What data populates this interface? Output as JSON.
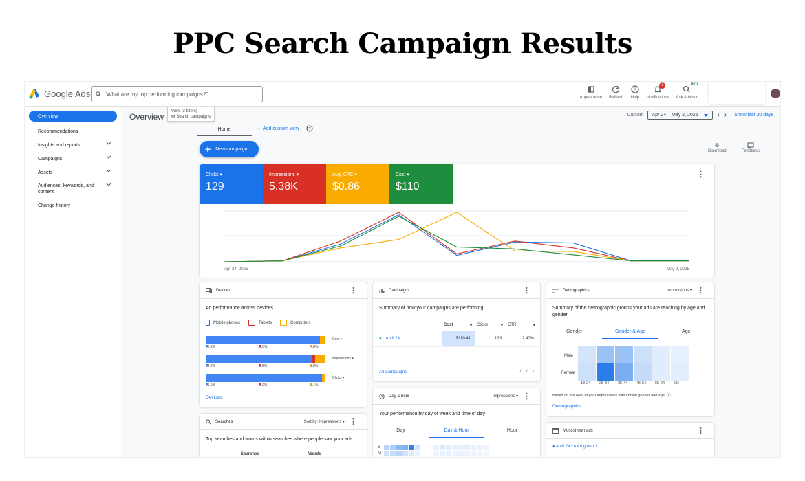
{
  "headline": "PPC Search Campaign Results",
  "topbar": {
    "product": "Google Ads",
    "search_placeholder": "\"What are my top performing campaigns?\"",
    "tools": [
      {
        "label": "Appearance",
        "icon": "appearance-icon"
      },
      {
        "label": "Refresh",
        "icon": "refresh-icon"
      },
      {
        "label": "Help",
        "icon": "help-icon"
      },
      {
        "label": "Notifications",
        "icon": "bell-icon",
        "badge": "1"
      },
      {
        "label": "Ask Advisor",
        "icon": "advisor-icon",
        "tag": "BETA"
      }
    ]
  },
  "sidebar": {
    "items": [
      {
        "label": "Overview",
        "active": true
      },
      {
        "label": "Recommendations"
      },
      {
        "label": "Insights and reports",
        "expandable": true
      },
      {
        "label": "Campaigns",
        "expandable": true
      },
      {
        "label": "Assets",
        "expandable": true
      },
      {
        "label": "Audiences, keywords, and content",
        "expandable": true
      },
      {
        "label": "Change history"
      }
    ]
  },
  "header": {
    "title": "Overview",
    "tooltip_line1": "View (3 filters)",
    "tooltip_line2": "Search campaigns",
    "custom_label": "Custom",
    "date_range": "Apr 24 – May 2, 2025",
    "show_last": "Show last 30 days",
    "tab_home": "Home",
    "add_view": "Add custom view",
    "new_campaign": "New campaign",
    "download": "Download",
    "feedback": "Feedback"
  },
  "metrics": [
    {
      "label": "Clicks",
      "value": "129",
      "color": "#1a73e8"
    },
    {
      "label": "Impressions",
      "value": "5.38K",
      "color": "#d93025"
    },
    {
      "label": "Avg. CPC",
      "value": "$0.86",
      "color": "#f9ab00"
    },
    {
      "label": "Cost",
      "value": "$110",
      "color": "#1e8e3e"
    }
  ],
  "chart_data": {
    "type": "line",
    "x_start_label": "Apr 24, 2025",
    "x_end_label": "May 2, 2025",
    "series": [
      {
        "color": "#1a73e8",
        "values": [
          0,
          0.02,
          0.36,
          0.95,
          0.13,
          0.4,
          0.38,
          0.02,
          0.02
        ]
      },
      {
        "color": "#d93025",
        "values": [
          0,
          0.02,
          0.42,
          1.0,
          0.16,
          0.42,
          0.28,
          0.02,
          0.02
        ]
      },
      {
        "color": "#f9ab00",
        "values": [
          0,
          0.02,
          0.28,
          0.45,
          1.0,
          0.22,
          0.21,
          0.02,
          0.02
        ]
      },
      {
        "color": "#1e8e3e",
        "values": [
          0,
          0.02,
          0.32,
          0.92,
          0.3,
          0.26,
          0.14,
          0.02,
          0.02
        ]
      }
    ]
  },
  "devices": {
    "title": "Devices",
    "subtitle": "Ad performance across devices",
    "legend": [
      "Mobile phones",
      "Tablets",
      "Computers"
    ],
    "rows": [
      {
        "metric": "Cost",
        "mobile": 95.2,
        "tablet": 0.0,
        "computer": 4.8,
        "labels": [
          "95.2%",
          "0.0%",
          "4.8%"
        ]
      },
      {
        "metric": "Impressions",
        "mobile": 88.7,
        "tablet": 2.5,
        "computer": 8.9,
        "labels": [
          "88.7%",
          "2.5%",
          "8.9%"
        ]
      },
      {
        "metric": "Clicks",
        "mobile": 96.9,
        "tablet": 0.0,
        "computer": 3.1,
        "labels": [
          "96.9%",
          "0.0%",
          "3.1%"
        ]
      }
    ],
    "link": "Devices"
  },
  "campaigns": {
    "title": "Campaigns",
    "subtitle": "Summary of how your campaigns are performing",
    "columns": [
      "Cost",
      "Clicks",
      "CTR"
    ],
    "row": {
      "name": "April 24",
      "cost": "$110.41",
      "clicks": "129",
      "ctr": "2.40%"
    },
    "link": "All campaigns",
    "pager": "1 / 1"
  },
  "demographics": {
    "title": "Demographics",
    "metric": "Impressions",
    "subtitle": "Summary of the demographic groups your ads are reaching by age and gender",
    "tabs": [
      "Gender",
      "Gender & Age",
      "Age"
    ],
    "rows": [
      "Male",
      "Female"
    ],
    "ages": [
      "18-24",
      "25-34",
      "35-44",
      "45-54",
      "55-64",
      "65+"
    ],
    "male": [
      0.12,
      0.4,
      0.4,
      0.15,
      0.05,
      0.03
    ],
    "female": [
      0.15,
      0.95,
      0.55,
      0.2,
      0.06,
      0.04
    ],
    "note": "Based on the 84% of your impressions with known gender and age.",
    "link": "Demographics"
  },
  "dayhour": {
    "title": "Day & hour",
    "metric": "Impressions",
    "subtitle": "Your performance by day of week and time of day",
    "tabs": [
      "Day",
      "Day & Hour",
      "Hour"
    ],
    "days": [
      "S",
      "M"
    ]
  },
  "searches": {
    "title": "Searches",
    "sort_label": "Sort by:",
    "sort_value": "Impressions",
    "subtitle": "Top searches and words within searches where people saw your ads",
    "col1": "Searches",
    "col2": "Words"
  },
  "mostshown": {
    "title": "Most-shown ads",
    "crumb1": "April 24",
    "crumb2": "Ad group 1"
  }
}
